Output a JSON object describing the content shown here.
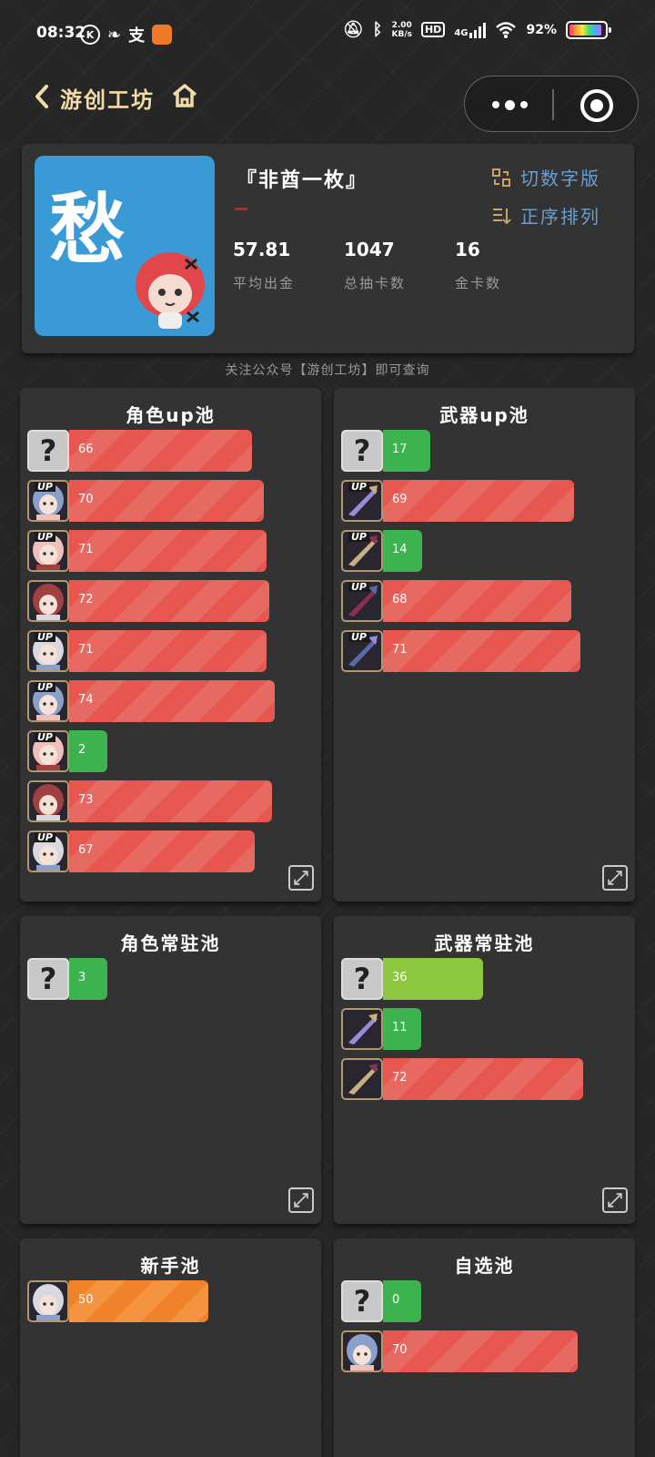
{
  "status_bar": {
    "time": "08:32",
    "speed_top": "2.00",
    "speed_unit": "KB/s",
    "hd": "HD",
    "network": "4G",
    "battery": "92%"
  },
  "nav": {
    "title": "游创工坊"
  },
  "profile": {
    "avatar_char": "愁",
    "username": "『非酋一枚』",
    "switch_font": "切数字版",
    "sort": "正序排列",
    "stats": [
      {
        "value": "57.81",
        "label": "平均出金"
      },
      {
        "value": "1047",
        "label": "总抽卡数"
      },
      {
        "value": "16",
        "label": "金卡数"
      }
    ]
  },
  "tip": "关注公众号【游创工坊】即可查询",
  "pools": [
    {
      "title": "角色up池",
      "items": [
        {
          "value": "66",
          "color": "red",
          "thumb": "unknown"
        },
        {
          "value": "70",
          "color": "red",
          "thumb": "character",
          "up": "UP"
        },
        {
          "value": "71",
          "color": "red",
          "thumb": "character",
          "up": "UP"
        },
        {
          "value": "72",
          "color": "red",
          "thumb": "character"
        },
        {
          "value": "71",
          "color": "red",
          "thumb": "character",
          "up": "UP"
        },
        {
          "value": "74",
          "color": "red",
          "thumb": "character",
          "up": "UP"
        },
        {
          "value": "2",
          "color": "green",
          "thumb": "character",
          "up": "UP"
        },
        {
          "value": "73",
          "color": "red",
          "thumb": "character"
        },
        {
          "value": "67",
          "color": "red",
          "thumb": "character",
          "up": "UP"
        }
      ]
    },
    {
      "title": "武器up池",
      "items": [
        {
          "value": "17",
          "color": "green",
          "thumb": "unknown"
        },
        {
          "value": "69",
          "color": "red",
          "thumb": "weapon",
          "up": "UP"
        },
        {
          "value": "14",
          "color": "green",
          "thumb": "weapon",
          "up": "UP"
        },
        {
          "value": "68",
          "color": "red",
          "thumb": "weapon",
          "up": "UP"
        },
        {
          "value": "71",
          "color": "red",
          "thumb": "weapon",
          "up": "UP"
        }
      ]
    },
    {
      "title": "角色常驻池",
      "items": [
        {
          "value": "3",
          "color": "green",
          "thumb": "unknown"
        }
      ]
    },
    {
      "title": "武器常驻池",
      "items": [
        {
          "value": "36",
          "color": "lime",
          "thumb": "unknown"
        },
        {
          "value": "11",
          "color": "green",
          "thumb": "weapon"
        },
        {
          "value": "72",
          "color": "red",
          "thumb": "weapon"
        }
      ]
    },
    {
      "title": "新手池",
      "items": [
        {
          "value": "50",
          "color": "orange",
          "thumb": "character"
        }
      ]
    },
    {
      "title": "自选池",
      "items": [
        {
          "value": "0",
          "color": "green",
          "thumb": "unknown"
        },
        {
          "value": "70",
          "color": "red",
          "thumb": "character"
        }
      ]
    }
  ],
  "colors": {
    "background": "#262626",
    "panel": "#333333",
    "red": "#e8574f",
    "green": "#3db350",
    "lime": "#8dc63f",
    "orange": "#f0822a",
    "accent_blue": "#6a9fd0",
    "title_gold": "#f3dba8"
  }
}
